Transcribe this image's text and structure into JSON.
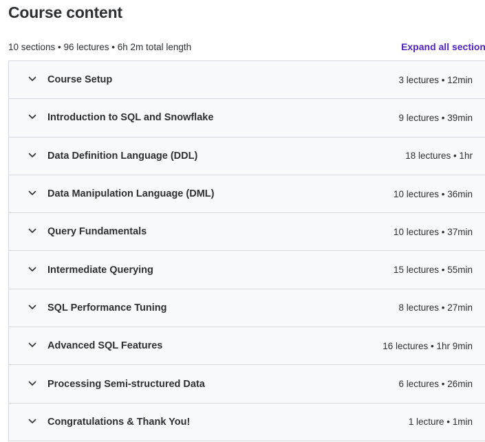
{
  "page": {
    "title": "Course content"
  },
  "summary": {
    "text": "10 sections • 96 lectures • 6h 2m total length",
    "expand_label": "Expand all section"
  },
  "colors": {
    "accent": "#5022c3",
    "row_background": "#f7f9fa",
    "border": "#d1d7dc",
    "text": "#2d2f31"
  },
  "sections": [
    {
      "title": "Course Setup",
      "meta": "3 lectures • 12min",
      "icon": "chevron-down-icon"
    },
    {
      "title": "Introduction to SQL and Snowflake",
      "meta": "9 lectures • 39min",
      "icon": "chevron-down-icon"
    },
    {
      "title": "Data Definition Language (DDL)",
      "meta": "18 lectures • 1hr",
      "icon": "chevron-down-icon"
    },
    {
      "title": "Data Manipulation Language (DML)",
      "meta": "10 lectures • 36min",
      "icon": "chevron-down-icon"
    },
    {
      "title": "Query Fundamentals",
      "meta": "10 lectures • 37min",
      "icon": "chevron-down-icon"
    },
    {
      "title": "Intermediate Querying",
      "meta": "15 lectures • 55min",
      "icon": "chevron-down-icon"
    },
    {
      "title": "SQL Performance Tuning",
      "meta": "8 lectures • 27min",
      "icon": "chevron-down-icon"
    },
    {
      "title": "Advanced SQL Features",
      "meta": "16 lectures • 1hr 9min",
      "icon": "chevron-down-icon"
    },
    {
      "title": "Processing Semi-structured Data",
      "meta": "6 lectures • 26min",
      "icon": "chevron-down-icon"
    },
    {
      "title": "Congratulations & Thank You!",
      "meta": "1 lecture • 1min",
      "icon": "chevron-down-icon"
    }
  ]
}
